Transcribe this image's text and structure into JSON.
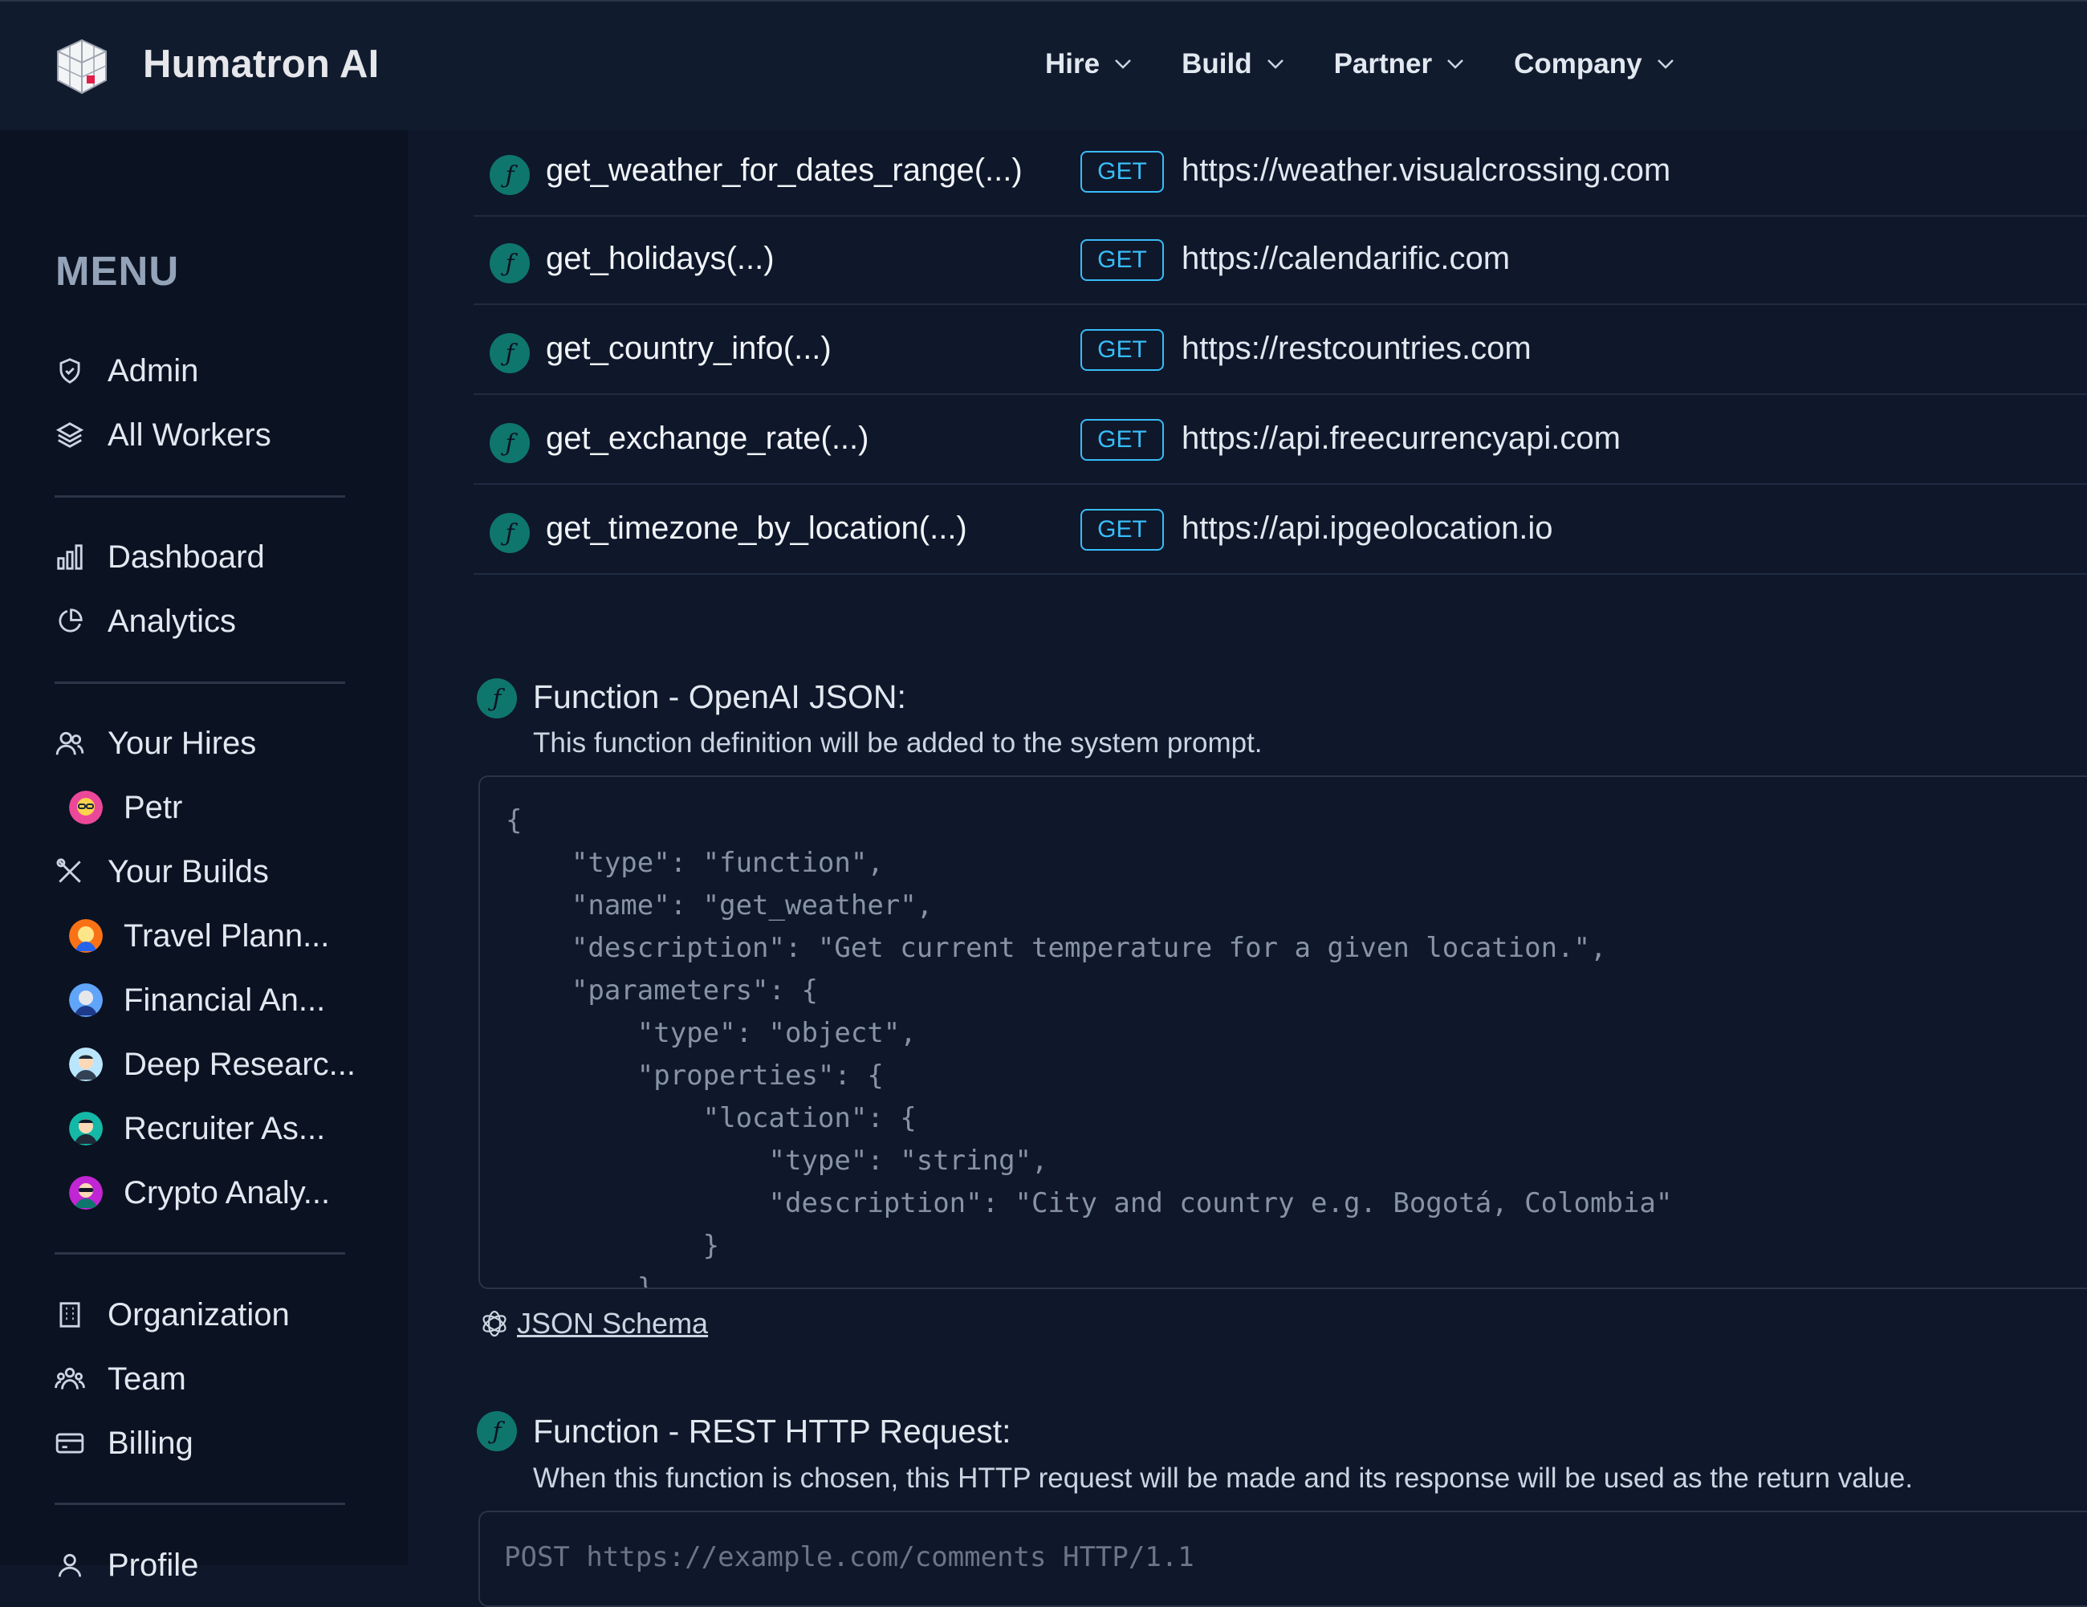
{
  "brand": {
    "name": "Humatron AI"
  },
  "nav": {
    "items": [
      {
        "label": "Hire"
      },
      {
        "label": "Build"
      },
      {
        "label": "Partner"
      },
      {
        "label": "Company"
      }
    ]
  },
  "sidebar": {
    "heading": "MENU",
    "admin": "Admin",
    "all_workers": "All Workers",
    "dashboard": "Dashboard",
    "analytics": "Analytics",
    "your_hires": "Your Hires",
    "hires": [
      {
        "label": "Petr"
      }
    ],
    "your_builds": "Your Builds",
    "builds": [
      {
        "label": "Travel Plann..."
      },
      {
        "label": "Financial An..."
      },
      {
        "label": "Deep Researc..."
      },
      {
        "label": "Recruiter As..."
      },
      {
        "label": "Crypto Analy..."
      }
    ],
    "organization": "Organization",
    "team": "Team",
    "billing": "Billing",
    "profile": "Profile"
  },
  "functions": [
    {
      "name": "get_weather_for_dates_range(...)",
      "method": "GET",
      "url": "https://weather.visualcrossing.com"
    },
    {
      "name": "get_holidays(...)",
      "method": "GET",
      "url": "https://calendarific.com"
    },
    {
      "name": "get_country_info(...)",
      "method": "GET",
      "url": "https://restcountries.com"
    },
    {
      "name": "get_exchange_rate(...)",
      "method": "GET",
      "url": "https://api.freecurrencyapi.com"
    },
    {
      "name": "get_timezone_by_location(...)",
      "method": "GET",
      "url": "https://api.ipgeolocation.io"
    }
  ],
  "openai_section": {
    "title": "Function - OpenAI JSON:",
    "subtitle": "This function definition will be added to the system prompt.",
    "code": "{\n    \"type\": \"function\",\n    \"name\": \"get_weather\",\n    \"description\": \"Get current temperature for a given location.\",\n    \"parameters\": {\n        \"type\": \"object\",\n        \"properties\": {\n            \"location\": {\n                \"type\": \"string\",\n                \"description\": \"City and country e.g. Bogotá, Colombia\"\n            }\n        }",
    "schema_link": "JSON Schema"
  },
  "rest_section": {
    "title": "Function - REST HTTP Request:",
    "subtitle": "When this function is chosen, this HTTP request will be made and its response will be used as the return value.",
    "code": "POST https://example.com/comments HTTP/1.1"
  },
  "colors": {
    "background": "#0f172a",
    "sidebar": "#0b1222",
    "accent": "#38bdf8",
    "function_icon": "#0f766e"
  }
}
